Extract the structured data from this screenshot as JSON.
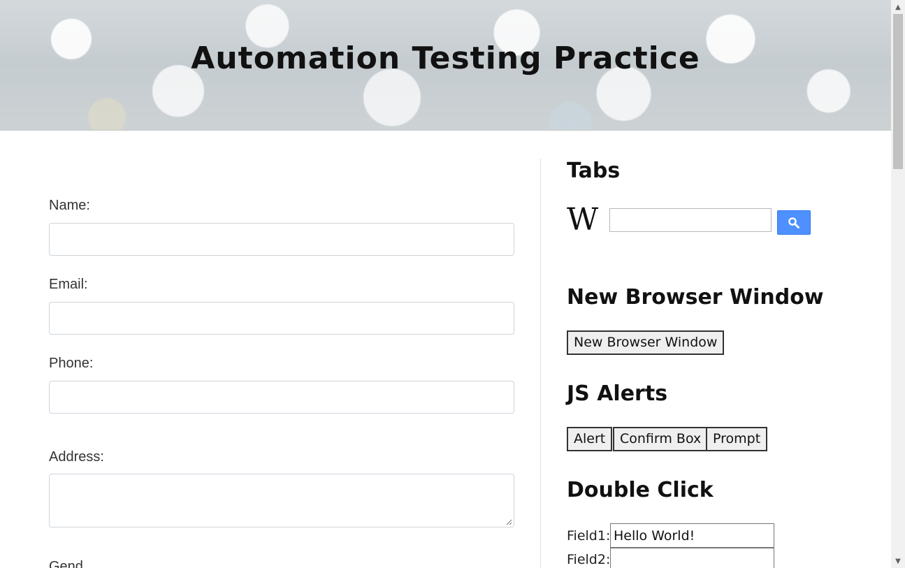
{
  "header": {
    "title": "Automation Testing Practice"
  },
  "form": {
    "name_label": "Name:",
    "email_label": "Email:",
    "phone_label": "Phone:",
    "address_label": "Address:",
    "gender_label_partial": "Gend"
  },
  "tabs": {
    "title": "Tabs",
    "wiki_logo": "W",
    "search_value": "",
    "search_icon": "search-icon",
    "search_button_color": "#4d90fe"
  },
  "new_window": {
    "title": "New Browser Window",
    "button_label": "New Browser Window"
  },
  "alerts": {
    "title": "JS Alerts",
    "alert_label": "Alert",
    "confirm_label": "Confirm Box",
    "prompt_label": "Prompt"
  },
  "double_click": {
    "title": "Double Click",
    "field1_label": "Field1:",
    "field1_value": "Hello World!",
    "field2_label": "Field2:",
    "field2_value": ""
  }
}
